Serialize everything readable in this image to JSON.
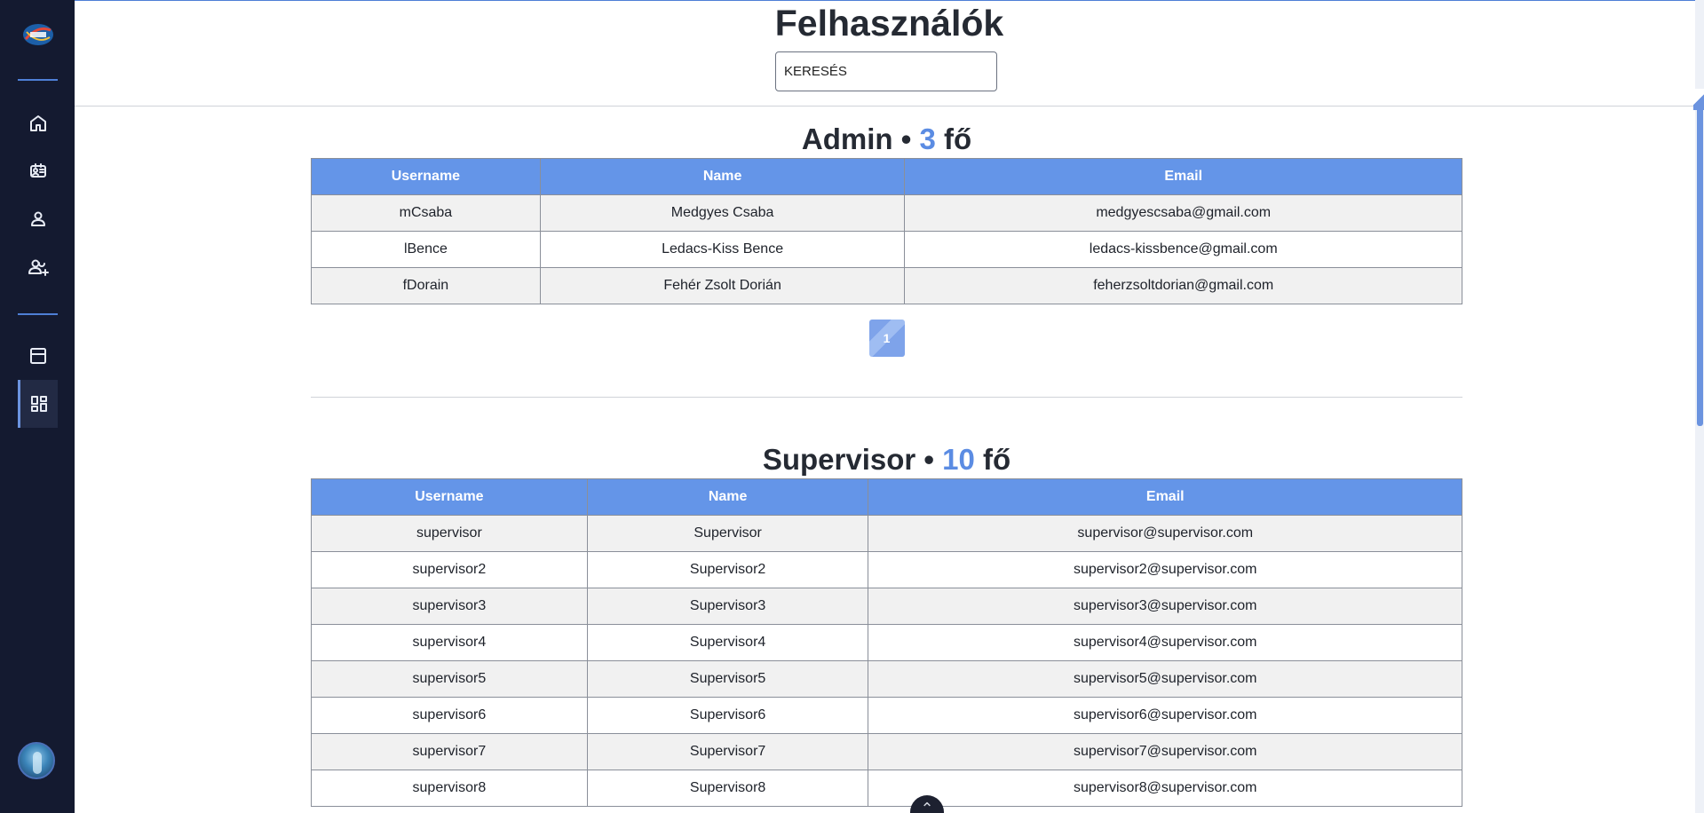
{
  "sidebar": {
    "logo": "sports-logo",
    "items": [
      {
        "icon": "home-icon",
        "active": false
      },
      {
        "icon": "id-card-icon",
        "active": false
      },
      {
        "icon": "user-icon",
        "active": false
      },
      {
        "icon": "user-add-icon",
        "active": false
      },
      {
        "icon": "calendar-icon",
        "active": false
      },
      {
        "icon": "dashboard-icon",
        "active": true
      }
    ],
    "avatar": "avatar"
  },
  "header": {
    "title": "Felhasználók",
    "search": {
      "value": "KERESÉS",
      "placeholder": ""
    }
  },
  "groups": [
    {
      "name": "Admin",
      "separator": " • ",
      "count": "3",
      "unit": " fő",
      "columns": [
        "Username",
        "Name",
        "Email"
      ],
      "rows": [
        [
          "mCsaba",
          "Medgyes Csaba",
          "medgyescsaba@gmail.com"
        ],
        [
          "lBence",
          "Ledacs-Kiss Bence",
          "ledacs-kissbence@gmail.com"
        ],
        [
          "fDorain",
          "Fehér Zsolt Dorián",
          "feherzsoltdorian@gmail.com"
        ]
      ],
      "page": "1"
    },
    {
      "name": "Supervisor",
      "separator": " • ",
      "count": "10",
      "unit": " fő",
      "columns": [
        "Username",
        "Name",
        "Email"
      ],
      "rows": [
        [
          "supervisor",
          "Supervisor",
          "supervisor@supervisor.com"
        ],
        [
          "supervisor2",
          "Supervisor2",
          "supervisor2@supervisor.com"
        ],
        [
          "supervisor3",
          "Supervisor3",
          "supervisor3@supervisor.com"
        ],
        [
          "supervisor4",
          "Supervisor4",
          "supervisor4@supervisor.com"
        ],
        [
          "supervisor5",
          "Supervisor5",
          "supervisor5@supervisor.com"
        ],
        [
          "supervisor6",
          "Supervisor6",
          "supervisor6@supervisor.com"
        ],
        [
          "supervisor7",
          "Supervisor7",
          "supervisor7@supervisor.com"
        ],
        [
          "supervisor8",
          "Supervisor8",
          "supervisor8@supervisor.com"
        ]
      ]
    }
  ],
  "colors": {
    "sidebar": "#141a30",
    "accent": "#6495e8",
    "count": "#5b8ce3"
  }
}
